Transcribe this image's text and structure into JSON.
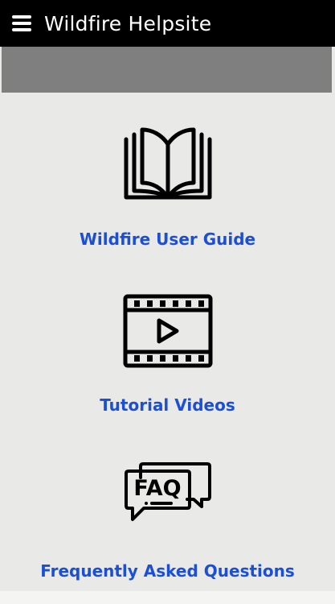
{
  "header": {
    "title": "Wildfire Helpsite",
    "menu_icon": "hamburger-menu-icon"
  },
  "sections": [
    {
      "label": "Wildfire User Guide",
      "icon": "open-book-icon"
    },
    {
      "label": "Tutorial Videos",
      "icon": "film-strip-play-icon"
    },
    {
      "label": "Frequently Asked Questions",
      "icon": "faq-speech-bubbles-icon",
      "icon_text": "FAQ"
    }
  ],
  "colors": {
    "header_bg": "#000000",
    "banner_bg": "#7f7f7f",
    "page_bg": "#e9e9e7",
    "link": "#1a4fd6"
  }
}
